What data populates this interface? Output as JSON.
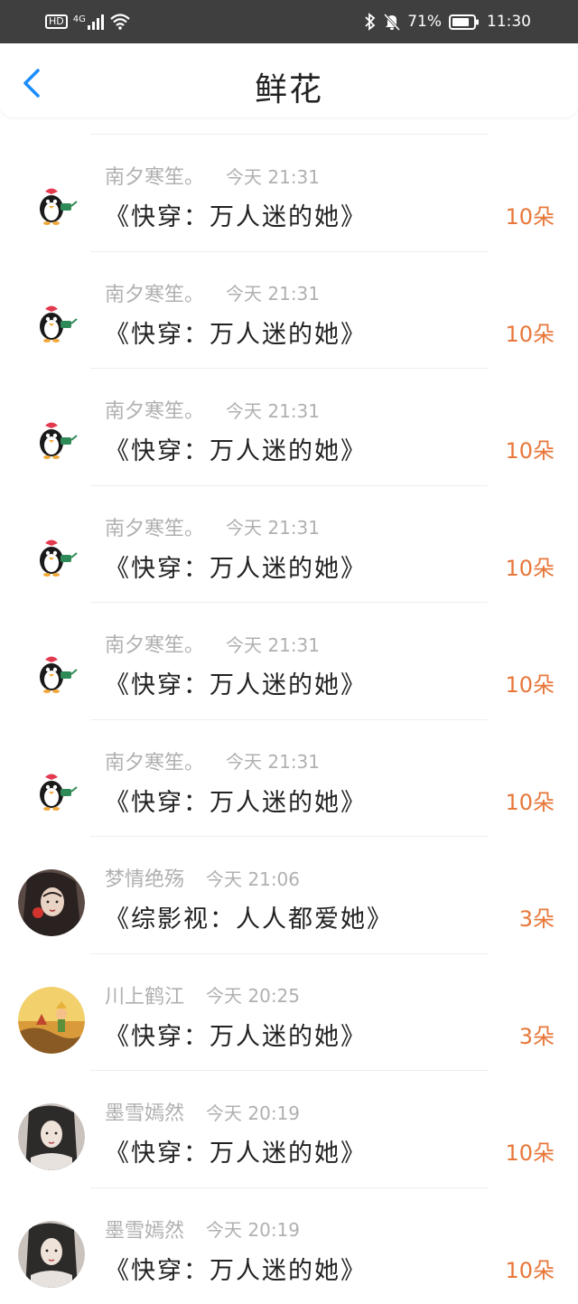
{
  "status_bar": {
    "hd": "HD",
    "network": "4G",
    "battery_percent": "71%",
    "time": "11:30"
  },
  "header": {
    "title": "鲜花"
  },
  "icons": {
    "back": "chevron-left-icon",
    "bluetooth": "bluetooth-icon",
    "mute": "bell-off-icon",
    "battery": "battery-icon",
    "wifi": "wifi-icon",
    "signal": "signal-icon"
  },
  "colors": {
    "accent": "#1a8cff",
    "amount": "#e8773a",
    "meta": "#b0b0b0",
    "status_bar_bg": "#3f3f3f"
  },
  "items": [
    {
      "avatar": "penguin",
      "user": "南夕寒笙。",
      "time": "今天 21:31",
      "title": "《快穿：万人迷的她》",
      "amount": "10朵"
    },
    {
      "avatar": "penguin",
      "user": "南夕寒笙。",
      "time": "今天 21:31",
      "title": "《快穿：万人迷的她》",
      "amount": "10朵"
    },
    {
      "avatar": "penguin",
      "user": "南夕寒笙。",
      "time": "今天 21:31",
      "title": "《快穿：万人迷的她》",
      "amount": "10朵"
    },
    {
      "avatar": "penguin",
      "user": "南夕寒笙。",
      "time": "今天 21:31",
      "title": "《快穿：万人迷的她》",
      "amount": "10朵"
    },
    {
      "avatar": "penguin",
      "user": "南夕寒笙。",
      "time": "今天 21:31",
      "title": "《快穿：万人迷的她》",
      "amount": "10朵"
    },
    {
      "avatar": "penguin",
      "user": "南夕寒笙。",
      "time": "今天 21:31",
      "title": "《快穿：万人迷的她》",
      "amount": "10朵"
    },
    {
      "avatar": "girl-dark",
      "user": "梦情绝殇",
      "time": "今天 21:06",
      "title": "《综影视：人人都爱她》",
      "amount": "3朵"
    },
    {
      "avatar": "prince",
      "user": "川上鹤江",
      "time": "今天 20:25",
      "title": "《快穿：万人迷的她》",
      "amount": "3朵"
    },
    {
      "avatar": "girl-ancient",
      "user": "墨雪嫣然",
      "time": "今天 20:19",
      "title": "《快穿：万人迷的她》",
      "amount": "10朵"
    },
    {
      "avatar": "girl-ancient",
      "user": "墨雪嫣然",
      "time": "今天 20:19",
      "title": "《快穿：万人迷的她》",
      "amount": "10朵"
    }
  ]
}
